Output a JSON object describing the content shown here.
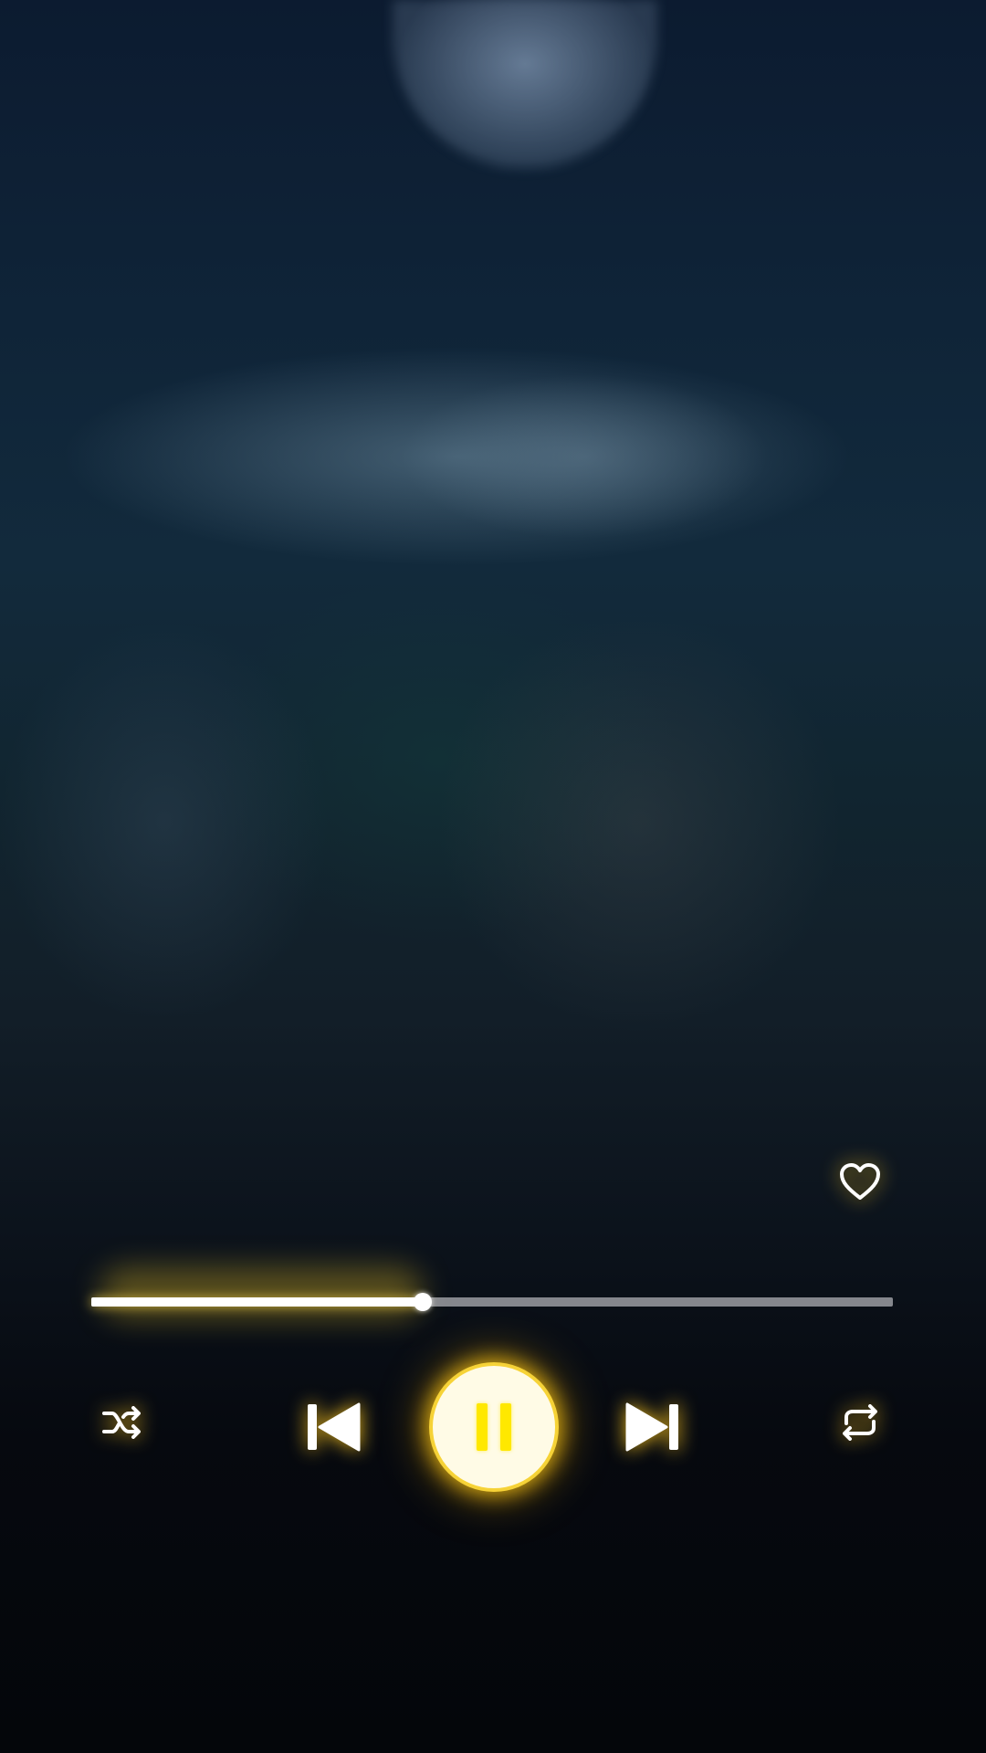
{
  "player": {
    "progress_fraction": 0.414,
    "icons": {
      "favorite": "heart-outline-icon",
      "shuffle": "shuffle-icon",
      "previous": "skip-previous-icon",
      "play_pause": "pause-icon",
      "next": "skip-next-icon",
      "repeat": "repeat-icon"
    },
    "colors": {
      "accent_glow": "#ffc81e",
      "pause_bars": "#ffe800",
      "play_button_bg": "#fffbe6",
      "progress_filled": "#ffffff",
      "progress_track": "#c8c8cd"
    }
  }
}
